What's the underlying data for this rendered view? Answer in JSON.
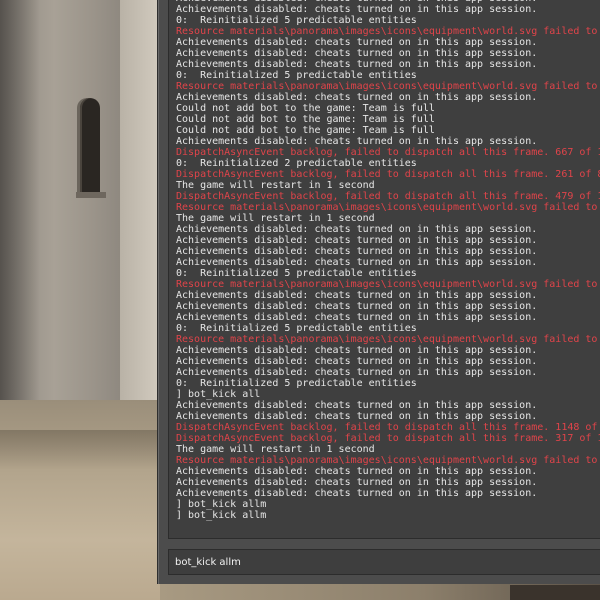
{
  "console": {
    "input_value": "bot_kick allm",
    "colors": {
      "normal_text": "#e6e6e6",
      "error_text": "#e0444a",
      "panel": "#4c4c4c",
      "log_bg": "#3f3f3f"
    },
    "lines": [
      {
        "text": "Achievements disabled: cheats turned on in this app session.",
        "type": "normal"
      },
      {
        "text": "Achievements disabled: cheats turned on in this app session.",
        "type": "normal"
      },
      {
        "text": "0:  Reinitialized 5 predictable entities",
        "type": "normal"
      },
      {
        "text": "Resource materials\\panorama\\images\\icons\\equipment\\world.svg failed to",
        "type": "error"
      },
      {
        "text": "Achievements disabled: cheats turned on in this app session.",
        "type": "normal"
      },
      {
        "text": "Achievements disabled: cheats turned on in this app session.",
        "type": "normal"
      },
      {
        "text": "Achievements disabled: cheats turned on in this app session.",
        "type": "normal"
      },
      {
        "text": "0:  Reinitialized 5 predictable entities",
        "type": "normal"
      },
      {
        "text": "Resource materials\\panorama\\images\\icons\\equipment\\world.svg failed to",
        "type": "error"
      },
      {
        "text": "Achievements disabled: cheats turned on in this app session.",
        "type": "normal"
      },
      {
        "text": "Could not add bot to the game: Team is full",
        "type": "normal"
      },
      {
        "text": "Could not add bot to the game: Team is full",
        "type": "normal"
      },
      {
        "text": "Could not add bot to the game: Team is full",
        "type": "normal"
      },
      {
        "text": "Achievements disabled: cheats turned on in this app session.",
        "type": "normal"
      },
      {
        "text": "DispatchAsyncEvent backlog, failed to dispatch all this frame. 667 of 1",
        "type": "error"
      },
      {
        "text": "0:  Reinitialized 2 predictable entities",
        "type": "normal"
      },
      {
        "text": "DispatchAsyncEvent backlog, failed to dispatch all this frame. 261 of 8",
        "type": "error"
      },
      {
        "text": "The game will restart in 1 second",
        "type": "normal"
      },
      {
        "text": "DispatchAsyncEvent backlog, failed to dispatch all this frame. 479 of 1",
        "type": "error"
      },
      {
        "text": "Resource materials\\panorama\\images\\icons\\equipment\\world.svg failed to",
        "type": "error"
      },
      {
        "text": "The game will restart in 1 second",
        "type": "normal"
      },
      {
        "text": "Achievements disabled: cheats turned on in this app session.",
        "type": "normal"
      },
      {
        "text": "Achievements disabled: cheats turned on in this app session.",
        "type": "normal"
      },
      {
        "text": "Achievements disabled: cheats turned on in this app session.",
        "type": "normal"
      },
      {
        "text": "Achievements disabled: cheats turned on in this app session.",
        "type": "normal"
      },
      {
        "text": "0:  Reinitialized 5 predictable entities",
        "type": "normal"
      },
      {
        "text": "Resource materials\\panorama\\images\\icons\\equipment\\world.svg failed to",
        "type": "error"
      },
      {
        "text": "Achievements disabled: cheats turned on in this app session.",
        "type": "normal"
      },
      {
        "text": "Achievements disabled: cheats turned on in this app session.",
        "type": "normal"
      },
      {
        "text": "Achievements disabled: cheats turned on in this app session.",
        "type": "normal"
      },
      {
        "text": "0:  Reinitialized 5 predictable entities",
        "type": "normal"
      },
      {
        "text": "Resource materials\\panorama\\images\\icons\\equipment\\world.svg failed to",
        "type": "error"
      },
      {
        "text": "Achievements disabled: cheats turned on in this app session.",
        "type": "normal"
      },
      {
        "text": "Achievements disabled: cheats turned on in this app session.",
        "type": "normal"
      },
      {
        "text": "Achievements disabled: cheats turned on in this app session.",
        "type": "normal"
      },
      {
        "text": "0:  Reinitialized 5 predictable entities",
        "type": "normal"
      },
      {
        "text": "] bot_kick all",
        "type": "normal"
      },
      {
        "text": "Achievements disabled: cheats turned on in this app session.",
        "type": "normal"
      },
      {
        "text": "Achievements disabled: cheats turned on in this app session.",
        "type": "normal"
      },
      {
        "text": "DispatchAsyncEvent backlog, failed to dispatch all this frame. 1148 of",
        "type": "error"
      },
      {
        "text": "DispatchAsyncEvent backlog, failed to dispatch all this frame. 317 of 1",
        "type": "error"
      },
      {
        "text": "The game will restart in 1 second",
        "type": "normal"
      },
      {
        "text": "Resource materials\\panorama\\images\\icons\\equipment\\world.svg failed to",
        "type": "error"
      },
      {
        "text": "Achievements disabled: cheats turned on in this app session.",
        "type": "normal"
      },
      {
        "text": "Achievements disabled: cheats turned on in this app session.",
        "type": "normal"
      },
      {
        "text": "Achievements disabled: cheats turned on in this app session.",
        "type": "normal"
      },
      {
        "text": "] bot_kick allm",
        "type": "normal"
      },
      {
        "text": "] bot_kick allm",
        "type": "normal"
      }
    ]
  }
}
